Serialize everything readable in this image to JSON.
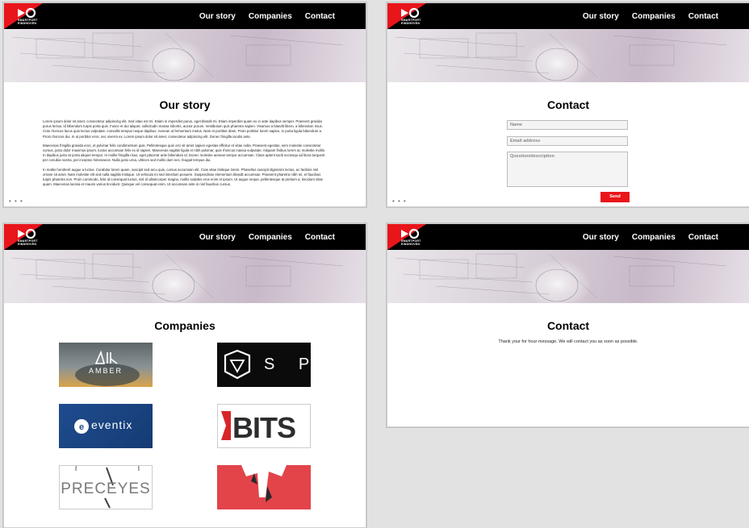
{
  "brand": {
    "logo_text_line1": "SMARTPORT",
    "logo_text_line2": "EINDHOVEN",
    "accent_color": "#e8151b"
  },
  "nav": {
    "items": [
      {
        "label": "Our story"
      },
      {
        "label": "Companies"
      },
      {
        "label": "Contact"
      }
    ]
  },
  "screens": {
    "story": {
      "title": "Our story",
      "paragraphs": [
        "Lorem ipsum dolor sit amet, consectetur adipiscing elit. Sed vitae est mi. Etiam in imperdiet purus, eget blandit mi. Etiam imperdiet quam ex in ante dapibus semper. Praesent gravida purus lectus, id bibendum turpis porta quis. Fusce et dui aliquet, sollicitudin massa lobortis, auctor purum. Vestibulum quis pharetra sapien. Vivamus a blandit libero, a bibendum risus. Cras rhoncus lacus quis lectus vulputate, convallis tempus neque dapibus. Aenean ut fermentum metus. Nam et porttitor diam. Proin porttitor lorem sapien, in porta ligula bibendum a. Proin rhoncus dui. In ut porttitor eros, nec viverra ex. Lorem ipsum dolor sit amet, consectetur adipiscing elit. Donec fringilla iaculis ante.",
        "Maecenas fringilla gravida eros, et pulvinar felis condimentum quis. Pellentesque quis orci sit amet sapien egestas efficitur et vitae nulla. Praesent egestas, sem molestie consectetur cursus, justo dolor maximus ipsum, luctus accumsan felis ex id sapien. Maecenas sagittis ligula et nibh pulvinar, quis rhoncus massa vulputate. Aliquam finibus lorem ac molestie mollis. In dapibus justo at porta aliquet tempor. In mollis fringilla risus, eget placerat ante bibendum id. Donec molestie aenean tempor accumsan. Class aptent taciti sociosqu ad litora torquent per conubia nostra, per inceptos himenaeos. Nulla justo urna, ultrices sed mollis dum nec, feugiat tempus dui.",
        "In mattis hendrerit augue a luctus. Curabitur lorem quam, suscipit sed arcu quis, cursus accumsan elit. Cras vitae tristique lorem. Phasellus suscipit dignissim lectus, ac facilisis nisl ornare sit amet. Nam molestie elit sed nulla sagittis tristique. Ut vehicula mi sed interdum posuere. Suspendisse elementum blandit accumsan. Praesent pharetra nibh mi, et faucibus turpis pharetra non. Proin commodo, felis id consequat luctus, nisl id ullamcorper magna, mollis sodales eros enim et ipsum. Ut augue neque, pellentesque at pretium a, tincidunt vitae quam. Maecenas lacinia et mauris varius tincidunt. Quisque vel consequat enim. Ut accumsan ante in nisl faucibus cursus."
      ]
    },
    "contact_form": {
      "title": "Contact",
      "name_placeholder": "Name",
      "email_placeholder": "Email address",
      "question_placeholder": "Question/description",
      "send_label": "Send"
    },
    "companies": {
      "title": "Companies",
      "logos": [
        {
          "label": "AMBER"
        },
        {
          "label": "S P"
        },
        {
          "label": "eventix"
        },
        {
          "label": "BITS"
        },
        {
          "label": "PRECEYES"
        },
        {
          "label": ""
        }
      ]
    },
    "contact_thanks": {
      "title": "Contact",
      "message": "Thank your for hour message. We will contact you as soon as possible."
    }
  },
  "pager_dots": "• • •"
}
